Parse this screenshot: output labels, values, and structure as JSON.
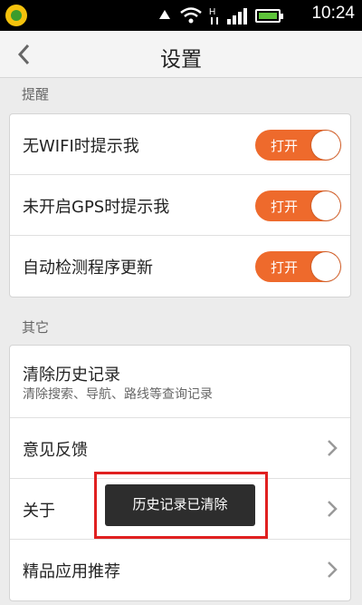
{
  "status_bar": {
    "time": "10:24",
    "app_icon": "orange-app-icon",
    "icons": [
      "shield-icon",
      "wifi-icon",
      "hplus-icon",
      "signal-icon",
      "battery-icon"
    ]
  },
  "header": {
    "title": "设置",
    "back_icon": "chevron-left-icon"
  },
  "section_reminders": {
    "label": "提醒",
    "items": [
      {
        "label": "无WIFI时提示我",
        "toggle": "打开"
      },
      {
        "label": "未开启GPS时提示我",
        "toggle": "打开"
      },
      {
        "label": "自动检测程序更新",
        "toggle": "打开"
      }
    ]
  },
  "section_other": {
    "label": "其它",
    "items": [
      {
        "label": "清除历史记录",
        "sub": "清除搜索、导航、路线等查询记录"
      },
      {
        "label": "意见反馈"
      },
      {
        "label": "关于"
      },
      {
        "label": "精品应用推荐"
      }
    ]
  },
  "toast": {
    "text": "历史记录已清除"
  },
  "colors": {
    "accent": "#ee6a2c",
    "highlight": "#e02020"
  }
}
